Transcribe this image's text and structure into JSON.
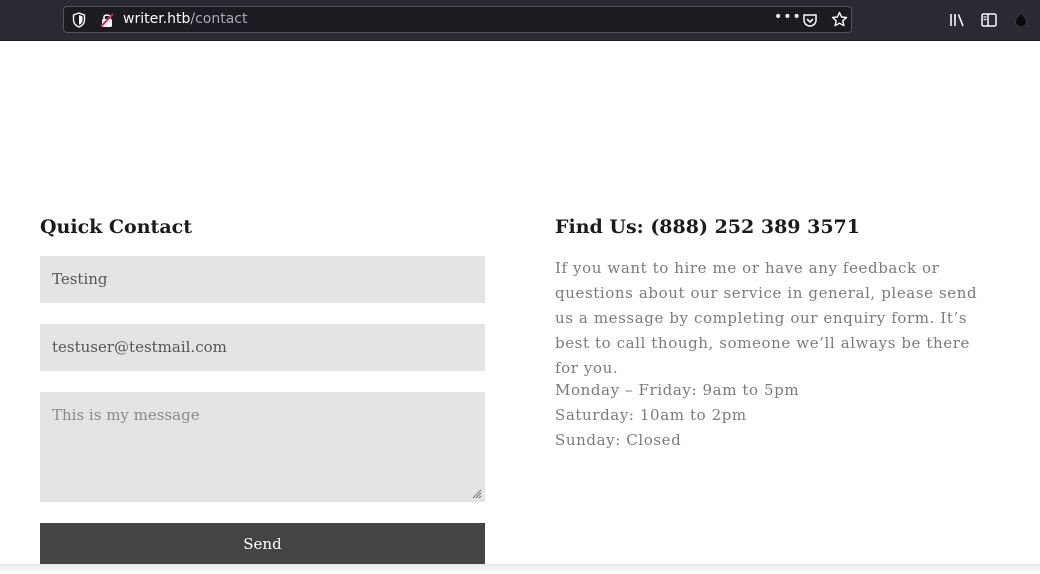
{
  "browser": {
    "url_host": "writer.htb",
    "url_path": "/contact",
    "more_label": "•••"
  },
  "contact": {
    "title": "Quick Contact",
    "name_value": "Testing",
    "email_value": "testuser@testmail.com",
    "message_placeholder": "This is my message",
    "send_label": "Send"
  },
  "find_us": {
    "title": "Find Us: (888) 252 389 3571",
    "description": "If you want to hire me or have any feedback or questions about our service in general, please send us a message by completing our enquiry form. It’s best to call though, someone we’ll always be there for you.",
    "hours": [
      "Monday – Friday: 9am to 5pm",
      "Saturday: 10am to 2pm",
      "Sunday: Closed"
    ]
  },
  "colors": {
    "chrome_bg": "#2b2a33",
    "field_bg": "#e4e4e4",
    "button_bg": "#444444"
  }
}
